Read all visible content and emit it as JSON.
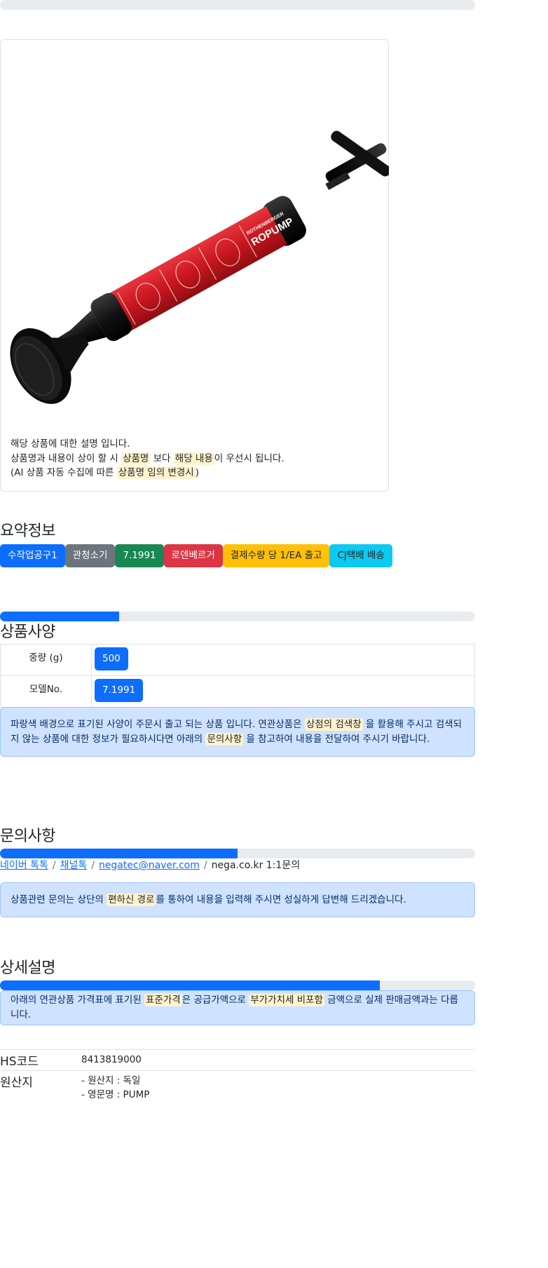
{
  "top_progress": {
    "value_pct": 0
  },
  "product_card": {
    "image_alt": "ROPUMP",
    "image_label": "ROPUMP",
    "image_brand": "ROTHENBERGER",
    "description": {
      "line1": "해당 상품에 대한 설명 입니다.",
      "line2_a": "상품명과 내용이 상이 할 시 ",
      "line2_mark1": "상품명",
      "line2_b": " 보다 ",
      "line2_mark2": "해당 내용",
      "line2_c": "이 우선시 됩니다.",
      "line3_a": "(AI 상품 자동 수집에 따른 ",
      "line3_mark": "상품명 임의 변경시",
      "line3_b": ")"
    }
  },
  "summary": {
    "title": "요약정보",
    "badges": [
      {
        "label": "수작업공구1",
        "color": "#0d6efd",
        "text_color": "#ffffff"
      },
      {
        "label": "관청소기",
        "color": "#6c757d",
        "text_color": "#ffffff"
      },
      {
        "label": "7.1991",
        "color": "#198754",
        "text_color": "#ffffff"
      },
      {
        "label": "로덴베르거",
        "color": "#dc3545",
        "text_color": "#ffffff"
      },
      {
        "label": "결제수량 당 1/EA 출고",
        "color": "#ffc107",
        "text_color": "#212529"
      },
      {
        "label": "CJ택배 배송",
        "color": "#0dcaf0",
        "text_color": "#212529"
      }
    ]
  },
  "specs": {
    "progress_pct": 25,
    "title": "상품사양",
    "rows": [
      {
        "label": "중량 (g)",
        "value": "500"
      },
      {
        "label": "모델No.",
        "value": "7.1991"
      }
    ],
    "notice": {
      "a": "파랑색 배경으로 표기된 사양이 주문시 출고 되는 상품 입니다. 연관상품은 ",
      "mark1": "상점의 검색창",
      "b": " 을 활용해 주시고 검색되지 않는 상품에 대한 정보가 필요하시다면 아래의 ",
      "mark2": "문의사항",
      "c": " 을 참고하여 내용을 전달하여 주시기 바랍니다."
    }
  },
  "inquiry": {
    "title": "문의사항",
    "progress_pct": 50,
    "links": [
      "네이버 톡톡",
      "채널톡",
      "negatec@naver.com"
    ],
    "plain": "nega.co.kr 1:1문의",
    "separator": "/",
    "notice": {
      "a": "상품관련 문의는 상단의 ",
      "mark": "편하신 경로",
      "b": "를 통하여 내용을 입력해 주시면 성실하게 답변해 드리겠습니다."
    }
  },
  "detail": {
    "title": "상세설명",
    "progress_pct": 80,
    "notice": {
      "a": "아래의 연관상품 가격표에 표기된 ",
      "mark1": "표준가격",
      "b": "은 공급가액으로 ",
      "mark2": "부가가치세 비포함",
      "c": " 금액으로 실제 판매금액과는 다릅니다."
    },
    "hs_label": "HS코드",
    "hs_value": "8413819000",
    "origin_label": "원산지",
    "origin_lines": [
      "- 원산지 : 독일",
      "- 영문명 : PUMP"
    ]
  }
}
